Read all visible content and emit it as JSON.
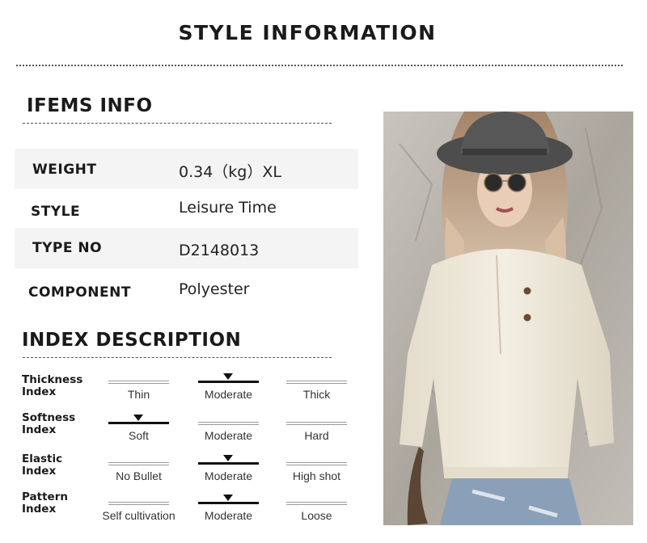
{
  "page_title": "STYLE INFORMATION",
  "items_info": {
    "heading": "IFEMS INFO",
    "rows": [
      {
        "label": "WEIGHT",
        "value": "0.34（kg）XL"
      },
      {
        "label": "STYLE",
        "value": "Leisure Time"
      },
      {
        "label": "TYPE NO",
        "value": "D2148013"
      },
      {
        "label": "COMPONENT",
        "value": "Polyester"
      }
    ]
  },
  "index_description": {
    "heading": "INDEX DESCRIPTION",
    "rows": [
      {
        "label_line1": "Thickness",
        "label_line2": "Index",
        "options": [
          "Thin",
          "Moderate",
          "Thick"
        ],
        "selected": 1
      },
      {
        "label_line1": "Softness",
        "label_line2": "Index",
        "options": [
          "Soft",
          "Moderate",
          "Hard"
        ],
        "selected": 0
      },
      {
        "label_line1": "Elastic",
        "label_line2": "Index",
        "options": [
          "No Bullet",
          "Moderate",
          "High shot"
        ],
        "selected": 1
      },
      {
        "label_line1": "Pattern",
        "label_line2": "Index",
        "options": [
          "Self cultivation",
          "Moderate",
          "Loose"
        ],
        "selected": 1
      }
    ]
  },
  "colors": {
    "accent": "#111111",
    "row_shade": "#f4f4f4",
    "sweater": "#efe8d8",
    "hat": "#505050",
    "wall": "#b8b3ab"
  }
}
